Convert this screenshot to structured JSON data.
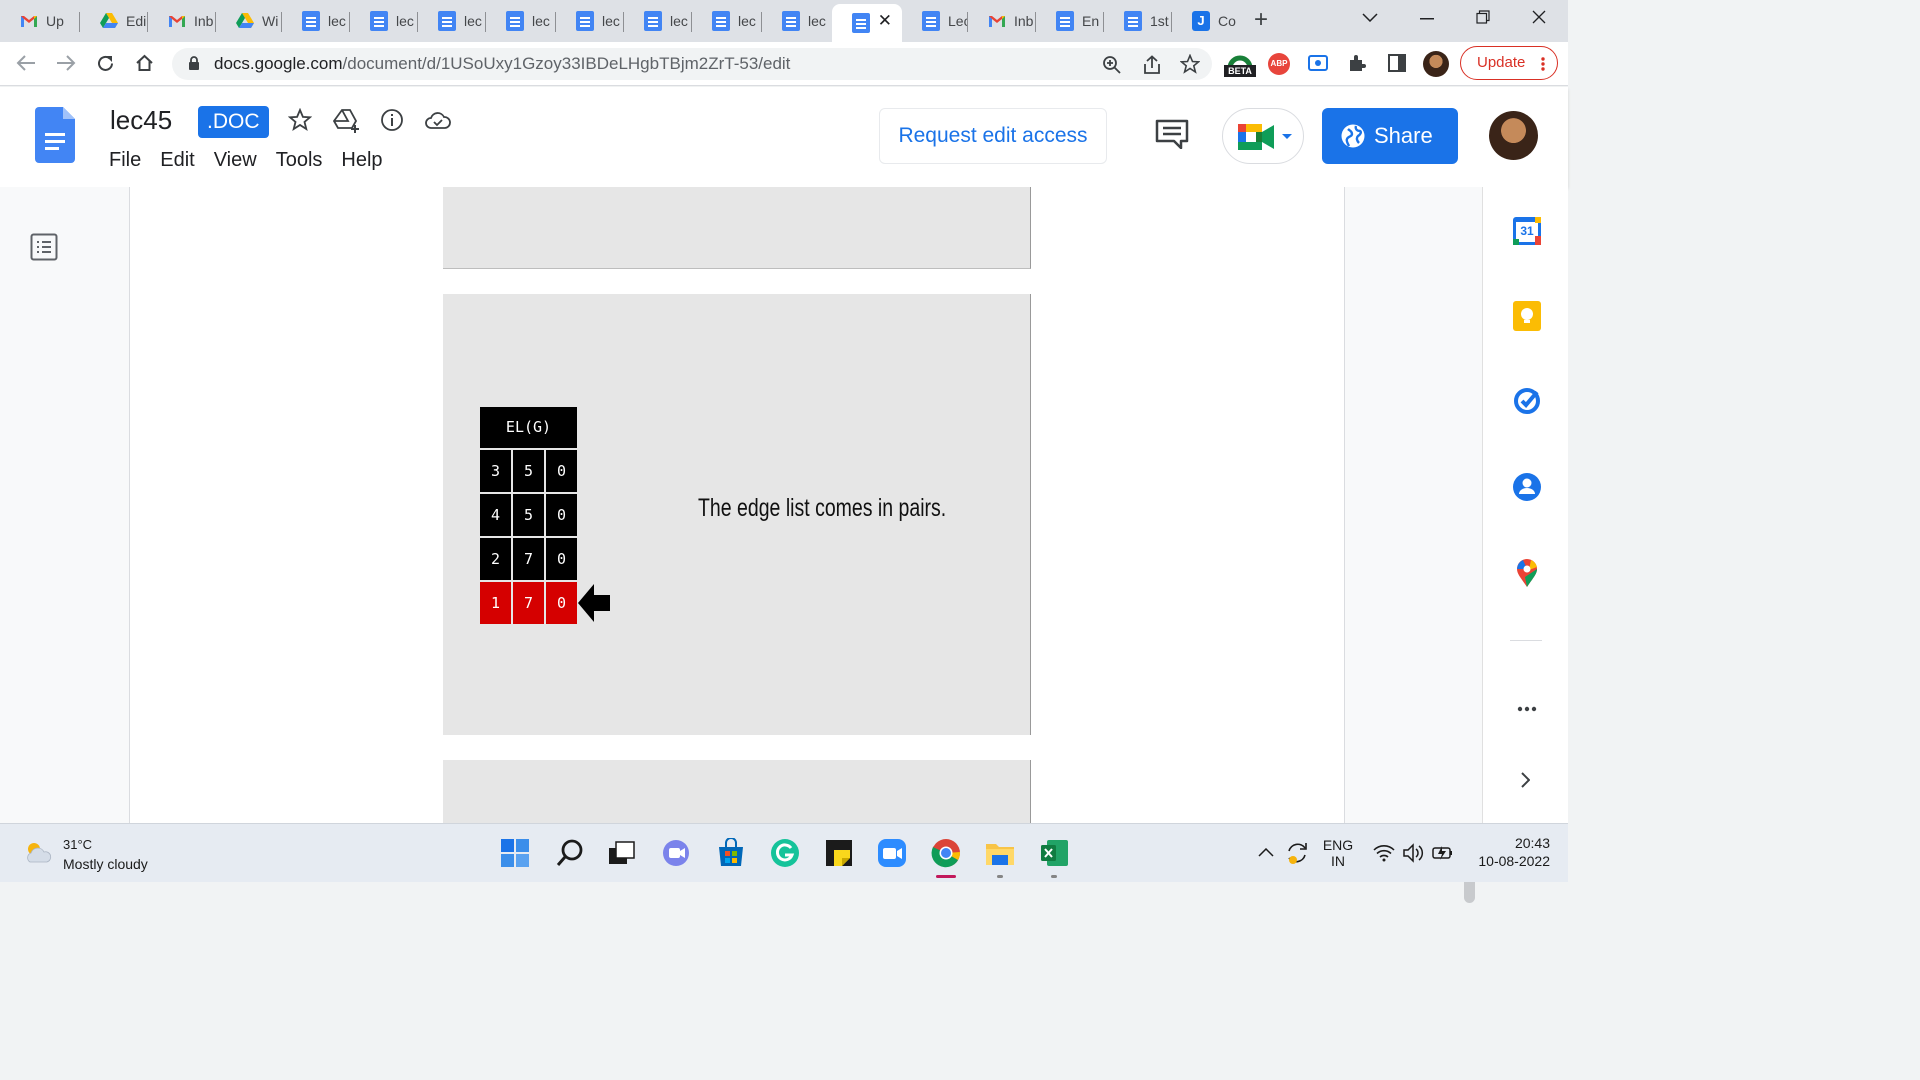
{
  "browser": {
    "tabs": [
      {
        "icon": "gmail",
        "label": "Up"
      },
      {
        "icon": "drive",
        "label": "Edi"
      },
      {
        "icon": "gmail",
        "label": "Inb"
      },
      {
        "icon": "drive",
        "label": "Wi"
      },
      {
        "icon": "doc",
        "label": "lec"
      },
      {
        "icon": "doc",
        "label": "lec"
      },
      {
        "icon": "doc",
        "label": "lec"
      },
      {
        "icon": "doc",
        "label": "lec"
      },
      {
        "icon": "doc",
        "label": "lec"
      },
      {
        "icon": "doc",
        "label": "lec"
      },
      {
        "icon": "doc",
        "label": "lec"
      },
      {
        "icon": "doc",
        "label": "lec"
      },
      {
        "icon": "doc",
        "label": ""
      },
      {
        "icon": "doc",
        "label": "Lec"
      },
      {
        "icon": "gmail",
        "label": "Inb"
      },
      {
        "icon": "doc",
        "label": "En"
      },
      {
        "icon": "doc",
        "label": "1st"
      },
      {
        "icon": "j",
        "label": "Co"
      }
    ],
    "url_host": "docs.google.com",
    "url_path": "/document/d/1USoUxy1Gzoy33IBDeLHgbTBjm2ZrT-53/edit",
    "ext_beta_label": "BETA",
    "ext_abp_label": "ABP",
    "update_label": "Update"
  },
  "docs": {
    "title": "lec45",
    "badge": ".DOC",
    "menu": [
      "File",
      "Edit",
      "View",
      "Tools",
      "Help"
    ],
    "request_edit_label": "Request edit access",
    "share_label": "Share"
  },
  "slide": {
    "table_header": "EL(G)",
    "rows": [
      {
        "cells": [
          "3",
          "5",
          "0"
        ],
        "highlighted": false
      },
      {
        "cells": [
          "4",
          "5",
          "0"
        ],
        "highlighted": false
      },
      {
        "cells": [
          "2",
          "7",
          "0"
        ],
        "highlighted": false
      },
      {
        "cells": [
          "1",
          "7",
          "0"
        ],
        "highlighted": true
      }
    ],
    "caption": "The edge list comes in pairs.",
    "highlight_color": "#d50000"
  },
  "side_panel": {
    "calendar_day": "31",
    "icons": [
      "calendar-icon",
      "keep-icon",
      "tasks-icon",
      "contacts-icon",
      "maps-icon",
      "more-icon",
      "expand-icon"
    ]
  },
  "taskbar": {
    "temperature": "31°C",
    "weather": "Mostly cloudy",
    "lang_line1": "ENG",
    "lang_line2": "IN",
    "time": "20:43",
    "date": "10-08-2022"
  },
  "colors": {
    "accent": "#1a73e8",
    "update_red": "#d93025"
  }
}
